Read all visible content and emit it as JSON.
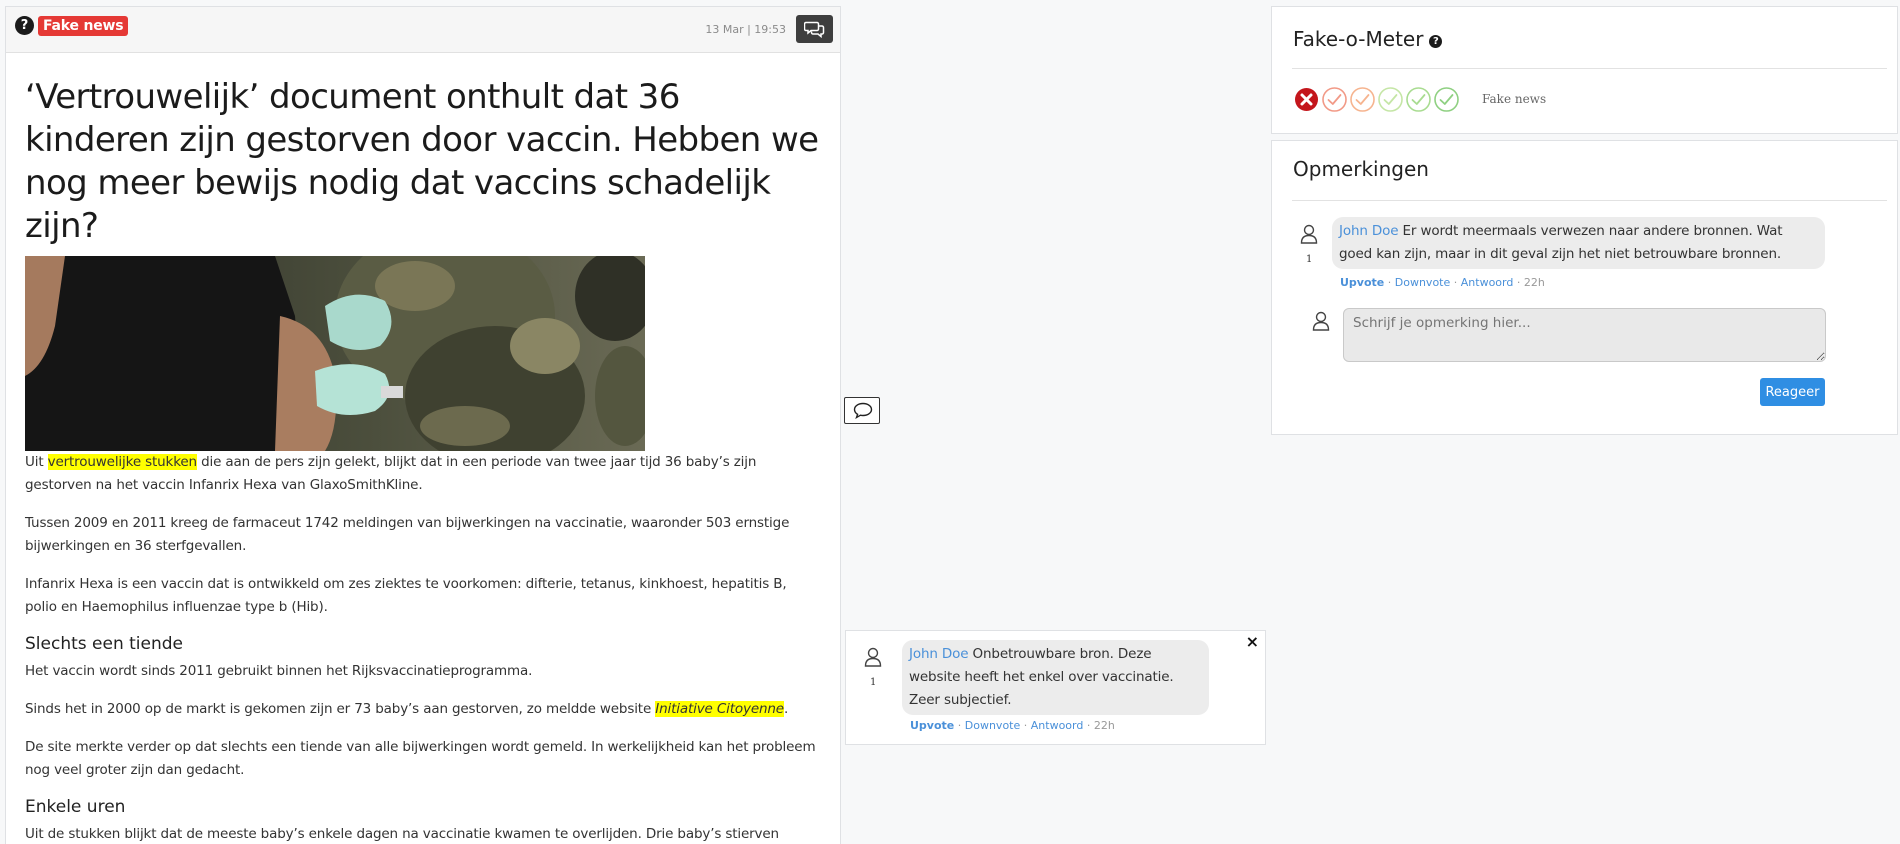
{
  "article": {
    "header": {
      "help_glyph": "?",
      "badge": "Fake news",
      "datetime": "13 Mar | 19:53",
      "comments_icon": "comments-icon"
    },
    "title": "‘Vertrouwelijk’ document onthult dat 36 kinderen zijn gestorven door vaccin. Hebben we nog meer bewijs nodig dat vaccins schadelijk zijn?",
    "p1": {
      "pre": "Uit ",
      "highlight": "vertrouwelijke stukken",
      "post": " die aan de pers zijn gelekt, blijkt dat in een periode van twee jaar tijd 36 baby’s zijn gestorven na het vaccin Infanrix Hexa van GlaxoSmithKline."
    },
    "p2": "Tussen 2009 en 2011 kreeg de farmaceut 1742 meldingen van bijwerkingen na vaccinatie, waaronder 503 ernstige bijwerkingen en 36 sterfgevallen.",
    "p3": "Infanrix Hexa is een vaccin dat is ontwikkeld om zes ziektes te voorkomen: difterie, tetanus, kinkhoest, hepatitis B, polio en Haemophilus influenzae type b (Hib).",
    "h1": "Slechts een tiende",
    "p4": "Het vaccin wordt sinds 2011 gebruikt binnen het Rijksvaccinatieprogramma.",
    "p5": {
      "pre": "Sinds het in 2000 op de markt is gekomen zijn er 73 baby’s aan gestorven, zo meldde website ",
      "highlight": "Initiative Citoyenne",
      "post": "."
    },
    "p6": "De site merkte verder op dat slechts een tiende van alle bijwerkingen wordt gemeld. In werkelijkheid kan het probleem nog veel groter zijn dan gedacht.",
    "h2": "Enkele uren",
    "p7": "Uit de stukken blijkt dat de meeste baby’s enkele dagen na vaccinatie kwamen te overlijden. Drie baby’s stierven binnen enkele uren nadat ze het vaccin hadden gekregen."
  },
  "annotation": {
    "author": "John Doe",
    "text": " Onbetrouwbare bron. Deze website heeft het enkel over vaccinatie. Zeer subjectief.",
    "votes": "1",
    "actions": {
      "upvote": "Upvote",
      "downvote": "Downvote",
      "reply": "Antwoord",
      "sep": " · ",
      "time": "22h"
    },
    "close_glyph": "×"
  },
  "meter": {
    "title": "Fake-o-Meter",
    "help_glyph": "?",
    "label": "Fake news",
    "levels": [
      {
        "icon": "x-circle-icon",
        "color": "#c4161c",
        "active": true
      },
      {
        "icon": "check-circle-icon",
        "color": "#f29a87",
        "active": false
      },
      {
        "icon": "check-circle-icon",
        "color": "#f6b48f",
        "active": false
      },
      {
        "icon": "check-circle-icon",
        "color": "#c5e6a6",
        "active": false
      },
      {
        "icon": "check-circle-icon",
        "color": "#a9dc91",
        "active": false
      },
      {
        "icon": "check-circle-icon",
        "color": "#8fd082",
        "active": false
      }
    ]
  },
  "remarks": {
    "title": "Opmerkingen",
    "comment": {
      "author": "John Doe",
      "text": " Er wordt meermaals verwezen naar andere bronnen. Wat goed kan zijn, maar in dit geval zijn het niet betrouwbare bronnen.",
      "votes": "1",
      "actions": {
        "upvote": "Upvote",
        "downvote": "Downvote",
        "reply": "Antwoord",
        "sep": " · ",
        "time": "22h"
      }
    },
    "input_placeholder": "Schrijf je opmerking hier...",
    "submit_label": "Reageer"
  }
}
